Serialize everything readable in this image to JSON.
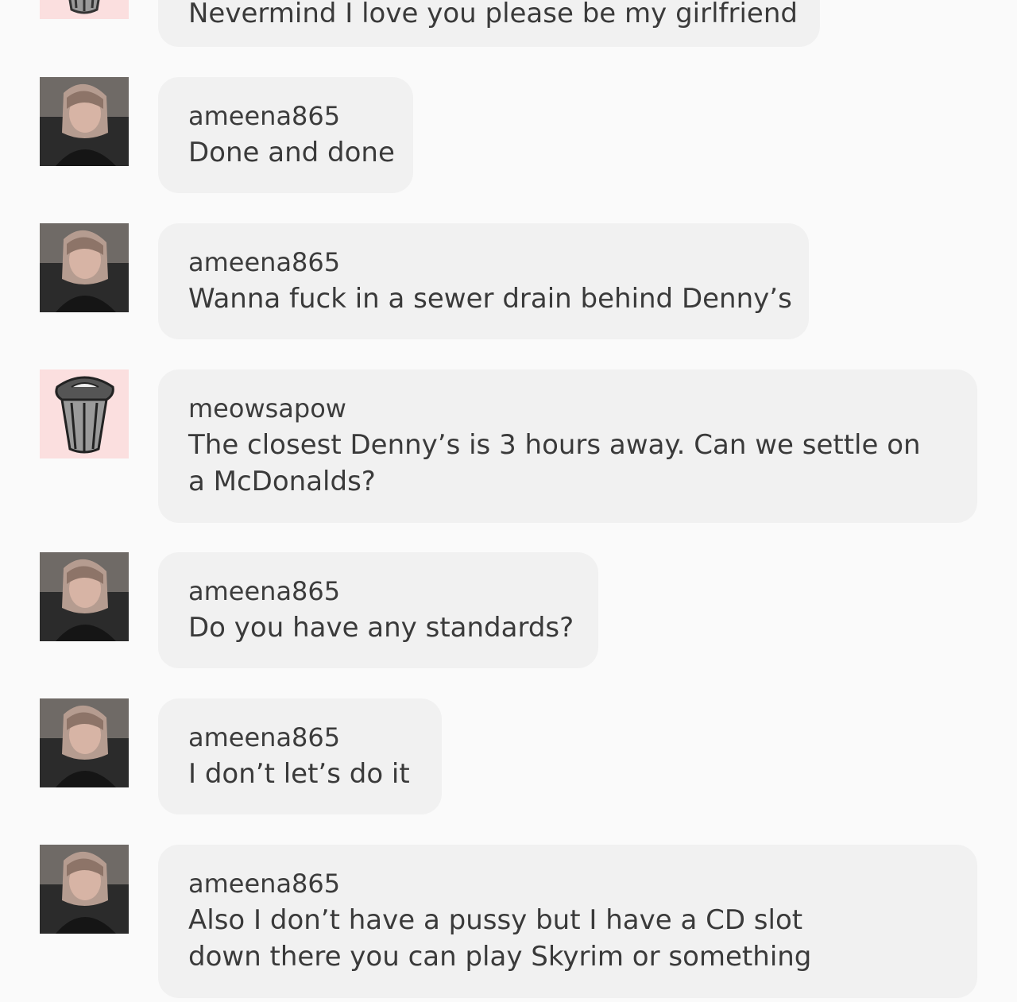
{
  "messages": [
    {
      "username": "",
      "text": "Nevermind I love you please be my girlfriend",
      "avatar": "trash-can-icon"
    },
    {
      "username": "ameena865",
      "text": "Done and done",
      "avatar": "user-photo"
    },
    {
      "username": "ameena865",
      "text": "Wanna fuck in a sewer drain behind Denny’s",
      "avatar": "user-photo"
    },
    {
      "username": "meowsapow",
      "text": "The closest Denny’s is 3 hours away. Can we settle on a McDonalds?",
      "avatar": "trash-can-icon"
    },
    {
      "username": "ameena865",
      "text": "Do you have any standards?",
      "avatar": "user-photo"
    },
    {
      "username": "ameena865",
      "text": "I don’t let’s do it",
      "avatar": "user-photo"
    },
    {
      "username": "ameena865",
      "text": "Also I don’t have a pussy but I have a CD slot down there you can play Skyrim or something",
      "avatar": "user-photo"
    }
  ],
  "colors": {
    "background": "#fafafa",
    "bubble": "#f1f1f1",
    "text": "#3a3a3a",
    "trash_avatar_bg": "#fbdfdf"
  }
}
